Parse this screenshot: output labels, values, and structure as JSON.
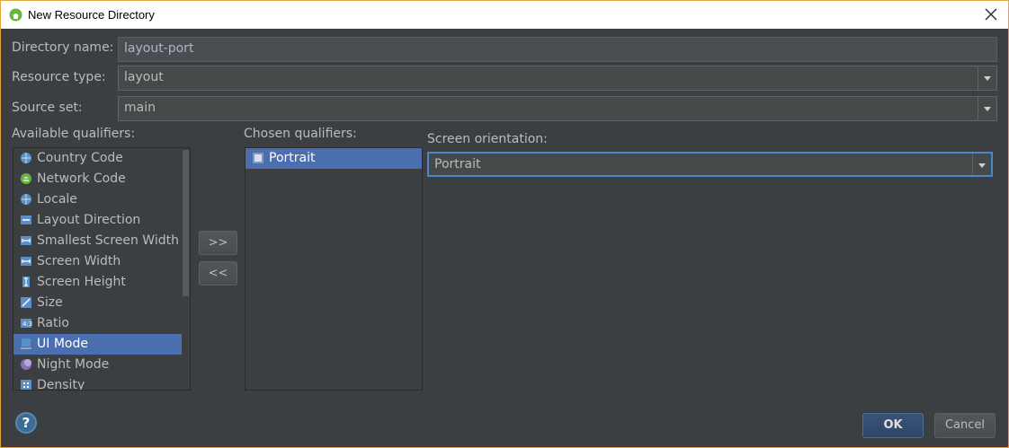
{
  "window": {
    "title": "New Resource Directory",
    "border_color": "#e6a23c"
  },
  "form": {
    "directory_name_label": "Directory name:",
    "directory_name_value": "layout-port",
    "resource_type_label": "Resource type:",
    "resource_type_value": "layout",
    "source_set_label": "Source set:",
    "source_set_value": "main"
  },
  "available": {
    "label": "Available qualifiers:",
    "items": [
      {
        "label": "Country Code",
        "icon": "globe-icon"
      },
      {
        "label": "Network Code",
        "icon": "network-icon"
      },
      {
        "label": "Locale",
        "icon": "globe-icon"
      },
      {
        "label": "Layout Direction",
        "icon": "layout-direction-icon"
      },
      {
        "label": "Smallest Screen Width",
        "icon": "screen-width-icon"
      },
      {
        "label": "Screen Width",
        "icon": "screen-width-icon"
      },
      {
        "label": "Screen Height",
        "icon": "screen-height-icon"
      },
      {
        "label": "Size",
        "icon": "size-icon"
      },
      {
        "label": "Ratio",
        "icon": "ratio-icon"
      },
      {
        "label": "UI Mode",
        "icon": "ui-mode-icon",
        "selected": true
      },
      {
        "label": "Night Mode",
        "icon": "night-mode-icon"
      },
      {
        "label": "Density",
        "icon": "density-icon"
      }
    ]
  },
  "transfer": {
    "add_label": ">>",
    "remove_label": "<<"
  },
  "chosen": {
    "label": "Chosen qualifiers:",
    "items": [
      {
        "label": "Portrait",
        "icon": "portrait-icon",
        "selected": true
      }
    ]
  },
  "orientation": {
    "label": "Screen orientation:",
    "value": "Portrait"
  },
  "footer": {
    "help_label": "?",
    "ok_label": "OK",
    "cancel_label": "Cancel"
  },
  "colors": {
    "background": "#3c3f41",
    "selection": "#4b6eaf",
    "accent": "#4a88c7"
  }
}
